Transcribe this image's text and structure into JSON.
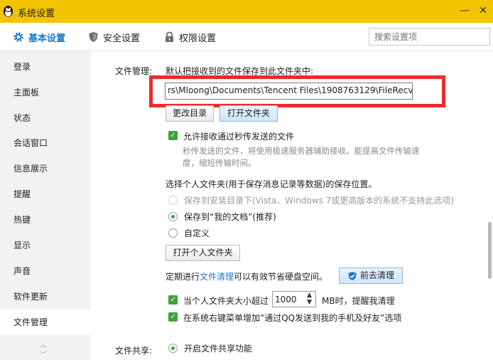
{
  "window": {
    "title": "系统设置",
    "minimize": "—",
    "close": "✕"
  },
  "tabs": [
    {
      "label": "基本设置"
    },
    {
      "label": "安全设置"
    },
    {
      "label": "权限设置"
    }
  ],
  "search": {
    "placeholder": "搜索设置项"
  },
  "sidebar": {
    "items": [
      {
        "label": "登录"
      },
      {
        "label": "主面板"
      },
      {
        "label": "状态"
      },
      {
        "label": "会话窗口"
      },
      {
        "label": "信息展示"
      },
      {
        "label": "提醒"
      },
      {
        "label": "热键"
      },
      {
        "label": "显示"
      },
      {
        "label": "声音"
      },
      {
        "label": "软件更新"
      },
      {
        "label": "文件管理"
      }
    ],
    "scroll_up": "︿",
    "scroll_down": "﹀"
  },
  "file_mgmt": {
    "section_label": "文件管理:",
    "save_prompt": "默认把接收到的文件保存到此文件夹中:",
    "path_value": "rs\\Mloong\\Documents\\Tencent Files\\1908763129\\FileRecv\\",
    "change_dir_btn": "更改目录",
    "open_folder_btn": "打开文件夹",
    "allow_instant_label": "允许接收通过秒传发送的文件",
    "instant_desc_1": "秒传发送的文件，将使用极速服务器辅助接收。能提高文件传输速",
    "instant_desc_2": "度，缩短传输时间。",
    "personal_folder_prompt": "选择个人文件夹(用于保存消息记录等数据)的保存位置。",
    "radio_install_dir": "保存到安装目录下(Vista、Windows 7或更高版本的系统不支持此选项)",
    "radio_my_docs": "保存到“我的文档”(推荐)",
    "radio_custom": "自定义",
    "open_personal_btn": "打开个人文件夹",
    "cleanup_prefix": "定期进行",
    "cleanup_link": "文件清理",
    "cleanup_suffix": "可以有效节省硬盘空间。",
    "cleanup_btn": "前去清理",
    "size_warn_label": "当个人文件夹大小超过",
    "size_value": "1000",
    "size_warn_suffix": "MB时，提醒我清理",
    "context_menu_label": "在系统右键菜单增加“通过QQ发送到我的手机及好友”选项"
  },
  "file_share": {
    "section_label": "文件共享:",
    "enable_label": "开启文件共享功能"
  },
  "colors": {
    "title_bar": "#f5c400",
    "accent": "#1a78c8",
    "highlight_box": "#ee2b2b",
    "check": "#3aa33a"
  }
}
